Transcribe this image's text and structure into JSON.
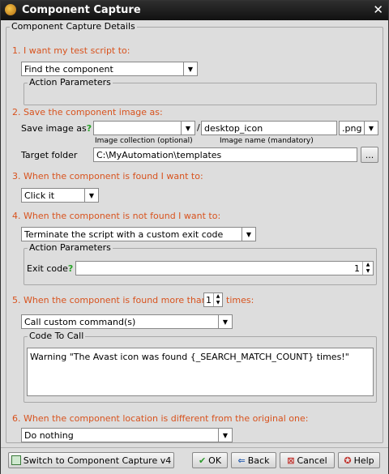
{
  "window": {
    "title": "Component Capture"
  },
  "details_legend": "Component Capture Details",
  "step1": {
    "label": "1. I want my test script to:",
    "dropdown_value": "Find the component",
    "params_legend": "Action Parameters"
  },
  "step2": {
    "label": "2. Save the component image as:",
    "save_image_label": "Save image as",
    "question": "?",
    "collection_value": "",
    "slash": "/",
    "image_name": "desktop_icon",
    "extension": ".png",
    "collection_caption": "Image collection (optional)",
    "name_caption": "Image name (mandatory)",
    "target_folder_label": "Target folder",
    "target_folder_value": "C:\\MyAutomation\\templates",
    "browse_label": "..."
  },
  "step3": {
    "label": "3. When the component is found I want to:",
    "dropdown_value": "Click it"
  },
  "step4": {
    "label": "4. When the component is not found I want to:",
    "dropdown_value": "Terminate the script with a custom exit code",
    "params_legend": "Action Parameters",
    "exit_code_label": "Exit code",
    "question": "?",
    "exit_code_value": "1"
  },
  "step5": {
    "label_before": "5. When the component is found more than",
    "count": "1",
    "label_after": "times:",
    "dropdown_value": "Call custom command(s)",
    "code_legend": "Code To Call",
    "code": "Warning \"The Avast icon was found {_SEARCH_MATCH_COUNT} times!\""
  },
  "step6": {
    "label": "6. When the component location is different from the original one:",
    "dropdown_value": "Do nothing"
  },
  "buttons": {
    "switch_label": "Switch to Component Capture v4",
    "ok_label": "OK",
    "back_label": "Back",
    "cancel_label": "Cancel",
    "help_label": "Help"
  },
  "colors": {
    "step_label": "#d8531e",
    "title_bar": "#1a1a1a"
  }
}
